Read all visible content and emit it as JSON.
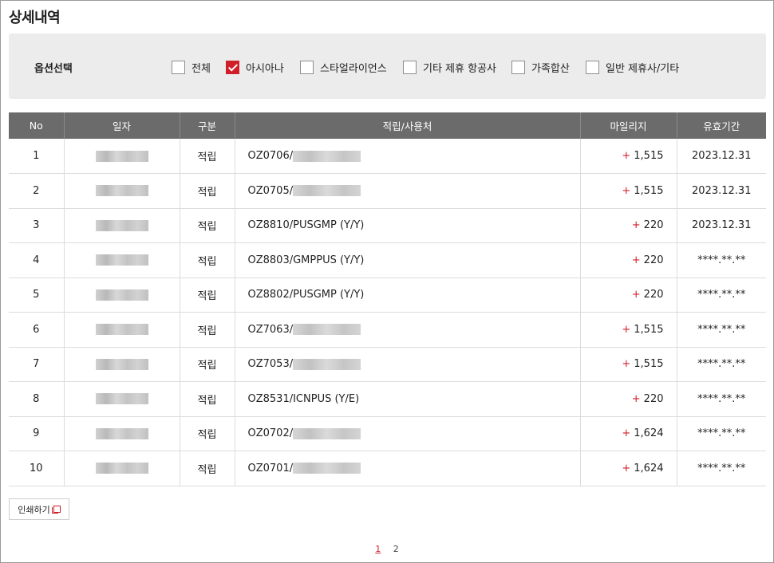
{
  "page": {
    "title": "상세내역"
  },
  "options": {
    "label": "옵션선택",
    "items": [
      {
        "label": "전체",
        "checked": false
      },
      {
        "label": "아시아나",
        "checked": true
      },
      {
        "label": "스타얼라이언스",
        "checked": false
      },
      {
        "label": "기타 제휴 항공사",
        "checked": false
      },
      {
        "label": "가족합산",
        "checked": false
      },
      {
        "label": "일반 제휴사/기타",
        "checked": false
      }
    ]
  },
  "table": {
    "columns": [
      "No",
      "일자",
      "구분",
      "적립/사용처",
      "마일리지",
      "유효기간"
    ],
    "rows": [
      {
        "no": "1",
        "type": "적립",
        "desc": "OZ0706/",
        "desc_blurred": true,
        "sign": "+",
        "miles": "1,515",
        "expiry": "2023.12.31"
      },
      {
        "no": "2",
        "type": "적립",
        "desc": "OZ0705/",
        "desc_blurred": true,
        "sign": "+",
        "miles": "1,515",
        "expiry": "2023.12.31"
      },
      {
        "no": "3",
        "type": "적립",
        "desc": "OZ8810/PUSGMP (Y/Y)",
        "desc_blurred": false,
        "sign": "+",
        "miles": "220",
        "expiry": "2023.12.31"
      },
      {
        "no": "4",
        "type": "적립",
        "desc": "OZ8803/GMPPUS (Y/Y)",
        "desc_blurred": false,
        "sign": "+",
        "miles": "220",
        "expiry": "****.**.**"
      },
      {
        "no": "5",
        "type": "적립",
        "desc": "OZ8802/PUSGMP (Y/Y)",
        "desc_blurred": false,
        "sign": "+",
        "miles": "220",
        "expiry": "****.**.**"
      },
      {
        "no": "6",
        "type": "적립",
        "desc": "OZ7063/",
        "desc_blurred": true,
        "sign": "+",
        "miles": "1,515",
        "expiry": "****.**.**"
      },
      {
        "no": "7",
        "type": "적립",
        "desc": "OZ7053/",
        "desc_blurred": true,
        "sign": "+",
        "miles": "1,515",
        "expiry": "****.**.**"
      },
      {
        "no": "8",
        "type": "적립",
        "desc": "OZ8531/ICNPUS (Y/E)",
        "desc_blurred": false,
        "sign": "+",
        "miles": "220",
        "expiry": "****.**.**"
      },
      {
        "no": "9",
        "type": "적립",
        "desc": "OZ0702/",
        "desc_blurred": true,
        "sign": "+",
        "miles": "1,624",
        "expiry": "****.**.**"
      },
      {
        "no": "10",
        "type": "적립",
        "desc": "OZ0701/",
        "desc_blurred": true,
        "sign": "+",
        "miles": "1,624",
        "expiry": "****.**.**"
      }
    ]
  },
  "print_button": {
    "label": "인쇄하기",
    "icon": "popup-window-icon"
  },
  "pagination": {
    "pages": [
      "1",
      "2"
    ],
    "current": "1"
  },
  "colors": {
    "accent": "#d11f2a",
    "header_bg": "#6b6b6b",
    "panel_bg": "#ececec"
  }
}
